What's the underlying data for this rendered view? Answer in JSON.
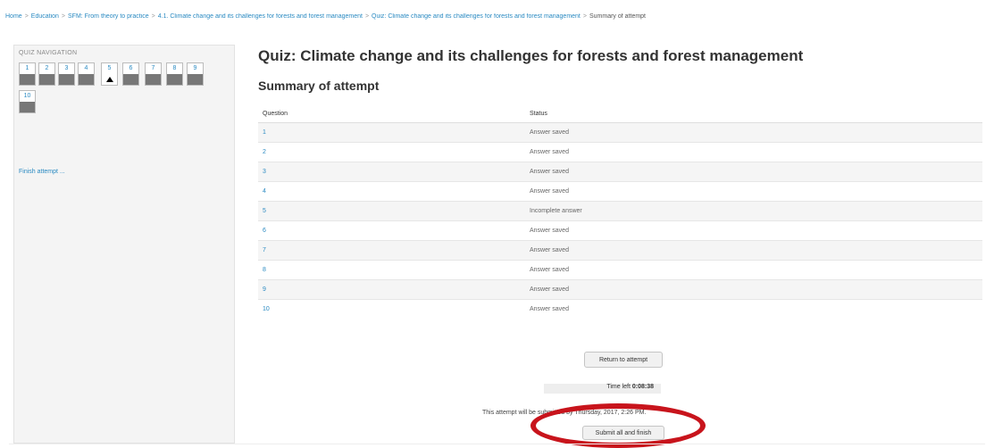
{
  "breadcrumb": [
    "Home",
    "Education",
    "SFM: From theory to practice",
    "4.1. Climate change and its challenges for forests and forest management",
    "Quiz: Climate change and its challenges for forests and forest management",
    "Summary of attempt"
  ],
  "quiz_navigation": {
    "title": "QUIZ NAVIGATION",
    "buttons": [
      "1",
      "2",
      "3",
      "4",
      "5",
      "6",
      "7",
      "8",
      "9",
      "10"
    ],
    "current": "5",
    "finish_link": "Finish attempt ..."
  },
  "main": {
    "title": "Quiz: Climate change and its challenges for forests and forest management",
    "summary_heading": "Summary of attempt"
  },
  "table": {
    "headers": [
      "Question",
      "Status"
    ],
    "rows": [
      {
        "question": "1",
        "status": "Answer saved"
      },
      {
        "question": "2",
        "status": "Answer saved"
      },
      {
        "question": "3",
        "status": "Answer saved"
      },
      {
        "question": "4",
        "status": "Answer saved"
      },
      {
        "question": "5",
        "status": "Incomplete answer"
      },
      {
        "question": "6",
        "status": "Answer saved"
      },
      {
        "question": "7",
        "status": "Answer saved"
      },
      {
        "question": "8",
        "status": "Answer saved"
      },
      {
        "question": "9",
        "status": "Answer saved"
      },
      {
        "question": "10",
        "status": "Answer saved"
      }
    ]
  },
  "actions": {
    "return_label": "Return to attempt",
    "time_left_label": "Time left",
    "time_left_value": "0:08:38",
    "deadline_text": "This attempt will be submitted by Thursday,         2017, 2:26 PM.",
    "submit_label": "Submit all and finish"
  },
  "colors": {
    "link": "#2a8ac2",
    "annotation_circle": "#c8141c",
    "nav_status_fill": "#777777"
  },
  "icons": {
    "current_question_marker": "up-triangle-icon"
  }
}
